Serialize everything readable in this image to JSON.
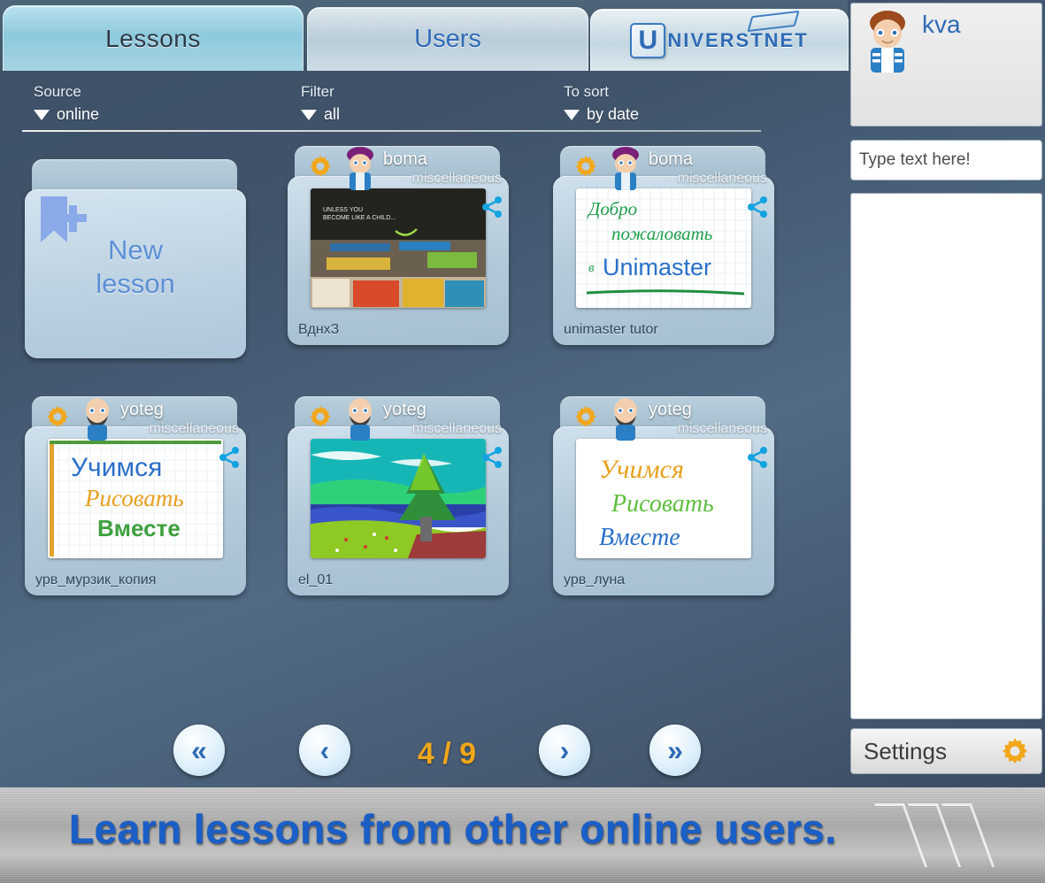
{
  "tabs": [
    {
      "id": "lessons",
      "label": "Lessons",
      "active": true
    },
    {
      "id": "users",
      "label": "Users",
      "active": false
    }
  ],
  "logo": {
    "first_letter": "U",
    "rest": "NIVERSTNET",
    "full": "UNIVERSTNET"
  },
  "filters": [
    {
      "id": "source",
      "title": "Source",
      "value": "online"
    },
    {
      "id": "filter",
      "title": "Filter",
      "value": "all"
    },
    {
      "id": "sort",
      "title": "To sort",
      "value": "by date"
    }
  ],
  "new_lesson": {
    "line1": "New",
    "line2": "lesson"
  },
  "cards": [
    {
      "user": "boma",
      "category": "miscellaneous",
      "name": "ВднхЗ",
      "thumb": "classroom-photo",
      "avatar": "boma-avatar"
    },
    {
      "user": "boma",
      "category": "miscellaneous",
      "name": "unimaster tutor",
      "thumb": "welcome-board",
      "thumb_text": "Добро пожаловать в Unimaster",
      "avatar": "boma-avatar"
    },
    {
      "user": "yoteg",
      "category": "miscellaneous",
      "name": "урв_мурзик_копия",
      "thumb": "learn-draw-board",
      "thumb_text": "Учимся Рисовать Вместе",
      "avatar": "yoteg-avatar"
    },
    {
      "user": "yoteg",
      "category": "miscellaneous",
      "name": "el_01",
      "thumb": "tree-landscape-painting",
      "avatar": "yoteg-avatar"
    },
    {
      "user": "yoteg",
      "category": "miscellaneous",
      "name": "урв_луна",
      "thumb": "learn-draw-script-board",
      "thumb_text": "Учимся Рисовать Вместе",
      "avatar": "yoteg-avatar"
    }
  ],
  "pager": {
    "first_label": "«",
    "prev_label": "‹",
    "next_label": "›",
    "last_label": "»",
    "current_page": 4,
    "total_pages": 9,
    "counter": "4 / 9"
  },
  "sidebar": {
    "profile_name": "kva",
    "chat_input_placeholder": "Type text here!",
    "chat_log": "",
    "settings_label": "Settings"
  },
  "footer": {
    "message": "Learn lessons from other online users."
  },
  "colors": {
    "accent_blue": "#2f6bb5",
    "gear_orange": "#f2a71b",
    "page_counter": "#f2a71b",
    "background": "#40536a",
    "card_body": "#b2c9d9",
    "footer_text": "#1a5fc8"
  },
  "icons": {
    "gear": "gear-icon",
    "share": "share-icon",
    "caret": "caret-down-icon",
    "bookmark_plus": "bookmark-plus-icon"
  }
}
